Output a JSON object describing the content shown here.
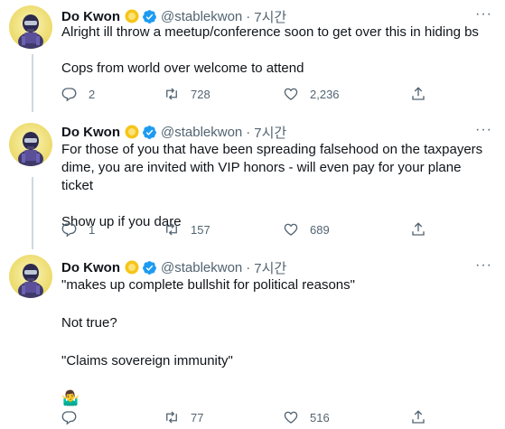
{
  "tweets": [
    {
      "author_name": "Do Kwon",
      "handle": "@stablekwon",
      "separator": "·",
      "time": "7시간",
      "lines": [
        "Alright ill throw a meetup/conference soon to get over this in hiding bs",
        "",
        "Cops from world over welcome to attend"
      ],
      "replies": "2",
      "retweets": "728",
      "likes": "2,236"
    },
    {
      "author_name": "Do Kwon",
      "handle": "@stablekwon",
      "separator": "·",
      "time": "7시간",
      "lines": [
        "For those of you that have been spreading falsehood on the taxpayers",
        "dime, you are invited with VIP honors - will even pay for your plane ticket",
        "",
        "Show up if you dare"
      ],
      "replies": "1",
      "retweets": "157",
      "likes": "689"
    },
    {
      "author_name": "Do Kwon",
      "handle": "@stablekwon",
      "separator": "·",
      "time": "7시간",
      "lines": [
        "\"makes up complete bullshit for political reasons\"",
        "",
        "Not true?",
        "",
        "\"Claims sovereign immunity\"",
        "",
        "🤷‍♂️"
      ],
      "replies": "",
      "retweets": "77",
      "likes": "516"
    }
  ],
  "more_label": "···",
  "colors": {
    "text": "#0f1419",
    "secondary": "#536471",
    "thread_line": "#cfd9de",
    "verified_blue": "#1d9bf0",
    "gold_badge": "#f5c518"
  },
  "icons": {
    "reply": "reply-icon",
    "retweet": "retweet-icon",
    "like": "heart-icon",
    "share": "share-icon",
    "verified": "verified-badge-icon",
    "gold": "gold-badge-icon",
    "more": "more-icon"
  }
}
